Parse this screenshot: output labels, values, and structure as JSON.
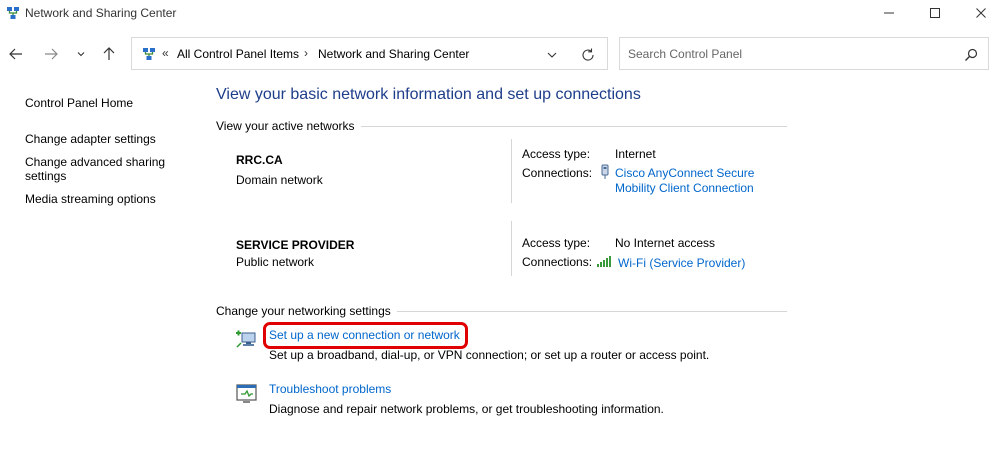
{
  "window": {
    "title": "Network and Sharing Center"
  },
  "address_bar": {
    "overflow": "«",
    "crumbs": [
      "All Control Panel Items",
      "Network and Sharing Center"
    ],
    "separator": "›"
  },
  "search": {
    "placeholder": "Search Control Panel"
  },
  "sidebar": {
    "home": "Control Panel Home",
    "items": [
      {
        "label": "Change adapter settings"
      },
      {
        "label_line1": "Change advanced sharing",
        "label_line2": "settings"
      },
      {
        "label": "Media streaming options"
      }
    ]
  },
  "main": {
    "title": "View your basic network information and set up connections",
    "active_networks_heading": "View your active networks",
    "networks": [
      {
        "name": "RRC.CA",
        "type": "Domain network",
        "access_type_label": "Access type:",
        "access_type": "Internet",
        "connections_label": "Connections:",
        "connection_line1": "Cisco AnyConnect Secure",
        "connection_line2": "Mobility Client Connection",
        "connection_icon": "vpn-adapter-icon"
      },
      {
        "name": "SERVICE PROVIDER",
        "type": "Public network",
        "access_type_label": "Access type:",
        "access_type": "No Internet access",
        "connections_label": "Connections:",
        "connection_line1": "Wi-Fi (Service Provider)",
        "connection_icon": "wifi-signal-icon"
      }
    ],
    "settings_heading": "Change your networking settings",
    "tasks": [
      {
        "link": "Set up a new connection or network",
        "description": "Set up a broadband, dial-up, or VPN connection; or set up a router or access point.",
        "icon": "new-connection-icon"
      },
      {
        "link": "Troubleshoot problems",
        "description": "Diagnose and repair network problems, or get troubleshooting information.",
        "icon": "troubleshoot-icon"
      }
    ]
  },
  "colors": {
    "link": "#0066cc",
    "title": "#1e3d8a",
    "highlight": "#e00000",
    "divider": "#d6d6d6"
  }
}
